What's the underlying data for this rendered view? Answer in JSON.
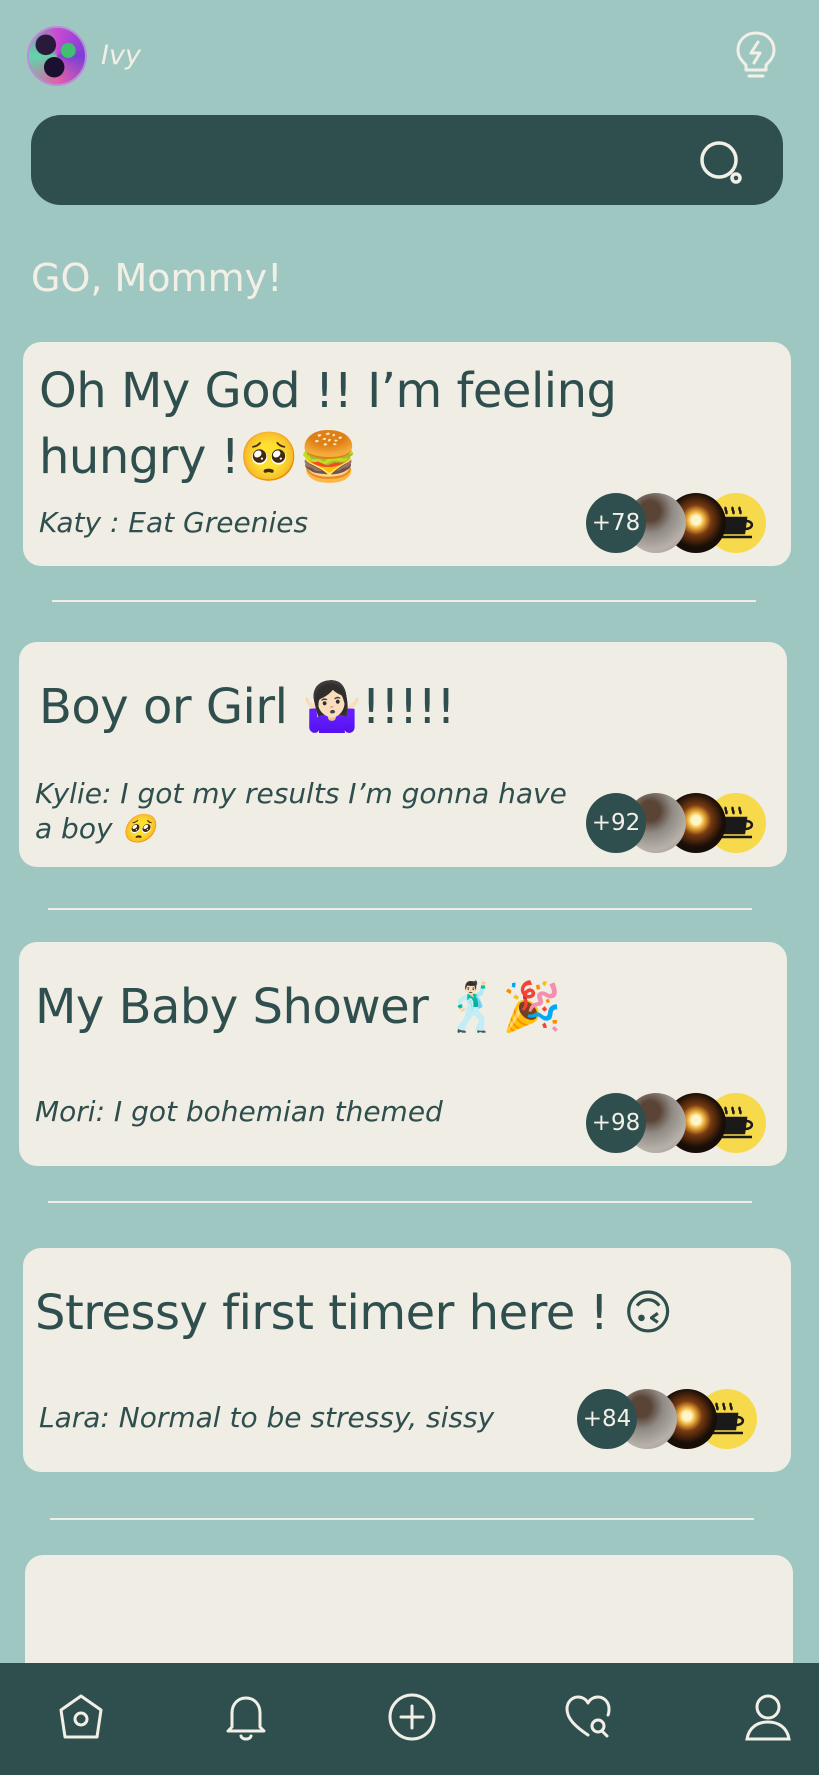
{
  "header": {
    "user_name": "Ivy",
    "avatar_icon": "avatar-image",
    "tip_icon": "lightbulb-icon"
  },
  "search": {
    "placeholder": "",
    "icon": "search-icon"
  },
  "greeting": "GO, Mommy!",
  "posts": [
    {
      "title": "Oh My God !! I’m feeling\nhungry !🥺🍔",
      "latest_reply": "Katy : Eat Greenies",
      "participants_more": "+78"
    },
    {
      "title": "Boy or Girl 🤷🏻‍♀️!!!!!",
      "latest_reply": "Kylie: I got my results I’m gonna have a boy 🥺",
      "participants_more": "+92"
    },
    {
      "title": "My Baby Shower 🕺🏻🎉",
      "latest_reply": "Mori: I got bohemian themed",
      "participants_more": "+98"
    },
    {
      "title": "Stressy first timer here ! 🙃",
      "latest_reply": "Lara: Normal to be stressy, sissy",
      "participants_more": "+84"
    }
  ],
  "nav": {
    "items": [
      "home-icon",
      "bell-icon",
      "add-icon",
      "heart-search-icon",
      "profile-icon"
    ]
  },
  "colors": {
    "background": "#9fc7c2",
    "dark": "#2f4f4f",
    "card": "#f0ede4"
  }
}
